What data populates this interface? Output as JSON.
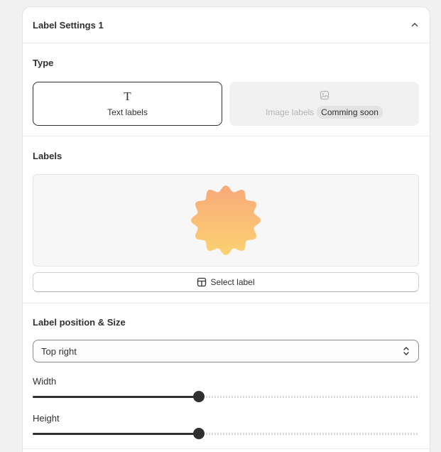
{
  "panel": {
    "title": "Label Settings 1",
    "collapse_icon": "chevron-up-icon"
  },
  "type_section": {
    "title": "Type",
    "options": [
      {
        "label": "Text labels",
        "glyph": "T",
        "icon": "text-type-icon",
        "selected": true
      },
      {
        "label": "Image labels",
        "icon": "image-icon",
        "badge": "Comming soon",
        "disabled": true
      }
    ]
  },
  "labels_section": {
    "title": "Labels",
    "preview_shape": "wavy-badge",
    "gradient_colors": [
      "#f9a97a",
      "#fad271"
    ],
    "select_button": "Select label",
    "select_icon": "layout-icon"
  },
  "position_section": {
    "title": "Label position & Size",
    "position_value": "Top right",
    "select_icon": "chevron-up-down-icon",
    "width_label": "Width",
    "width_fraction": 0.43,
    "height_label": "Height",
    "height_fraction": 0.43
  },
  "colors": {
    "accent": "#303030",
    "border": "#e3e3e3"
  }
}
